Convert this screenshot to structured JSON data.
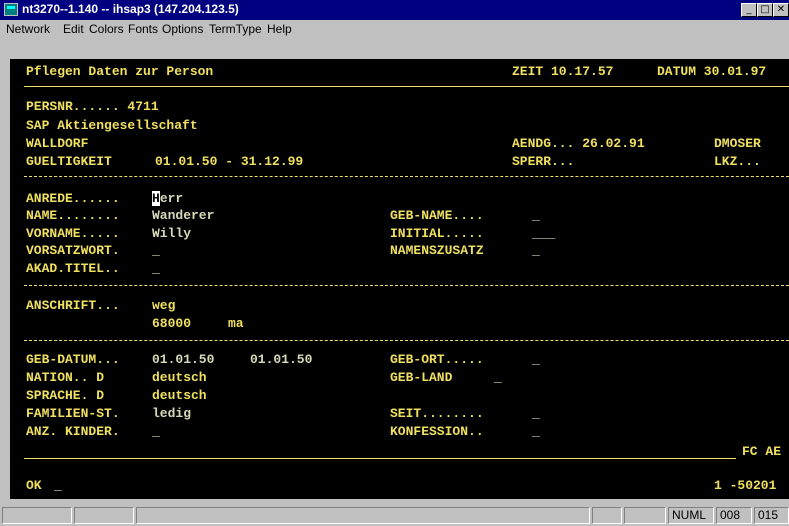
{
  "window": {
    "title": "nt3270--1.140  --  ihsap3 (147.204.123.5)",
    "minimize": "_",
    "maximize": "□",
    "close": "✕"
  },
  "menu": [
    "Network",
    "Edit",
    "Colors",
    "Fonts",
    "Options",
    "TermType",
    "Help"
  ],
  "screen": {
    "title": "Pflegen Daten zur Person",
    "time": "ZEIT 10.17.57",
    "date": "DATUM 30.01.97",
    "persnr": "PERSNR...... 4711",
    "company": "SAP Aktiengesellschaft",
    "city": "WALLDORF",
    "aendg": "AENDG... 26.02.91",
    "user": "DMOSER",
    "gueltigkeit_label": "GUELTIGKEIT",
    "gueltigkeit_value": "01.01.50 - 31.12.99",
    "sperr": "SPERR...",
    "lkz": "LKZ...",
    "anrede_label": "ANREDE......",
    "anrede_cursor": "H",
    "anrede_rest": "err",
    "name_label": "NAME........",
    "name_value": "Wanderer",
    "vorname_label": "VORNAME.....",
    "vorname_value": "Willy",
    "vorsatzwort_label": "VORSATZWORT.",
    "akad_titel_label": "AKAD.TITEL..",
    "geb_name_label": "GEB-NAME....",
    "initial_label": "INITIAL.....",
    "namenszusatz_label": "NAMENSZUSATZ",
    "anschrift_label": "ANSCHRIFT...",
    "street": "weg",
    "plz": "68000",
    "ort": "ma",
    "geb_datum_label": "GEB-DATUM...",
    "geb_datum_value1": "01.01.50",
    "geb_datum_value2": "01.01.50",
    "nation_label": "NATION.. D",
    "nation_value": "deutsch",
    "sprache_label": "SPRACHE. D",
    "sprache_value": "deutsch",
    "familien_label": "FAMILIEN-ST.",
    "familien_value": "ledig",
    "anz_kinder_label": "ANZ. KINDER.",
    "geb_ort_label": "GEB-ORT.....",
    "geb_land_label": "GEB-LAND",
    "seit_label": "SEIT........",
    "konfession_label": "KONFESSION..",
    "fc": "FC AE",
    "ok_label": "OK",
    "status_code": "1 -50201",
    "empty_field": "_",
    "empty_field_long": "___"
  },
  "statusbar": {
    "numl": "NUML",
    "row": "008",
    "col": "015"
  },
  "colors": {
    "terminal_bg": "#000000",
    "label": "#f0e060",
    "value": "#d8d8b8",
    "titlebar": "#000080"
  }
}
